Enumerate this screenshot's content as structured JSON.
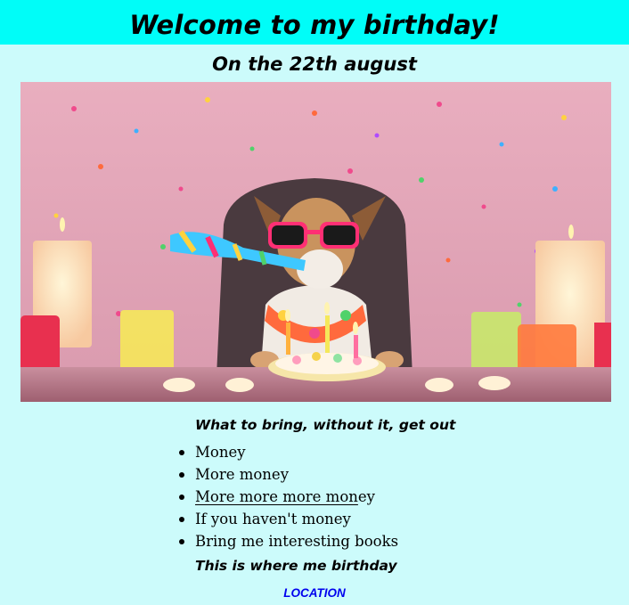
{
  "header": {
    "title": "Welcome to my birthday!",
    "subtitle": "On the 22th august"
  },
  "hero_image": {
    "icon": "party-dog-photo"
  },
  "bring": {
    "heading": "What to bring, without it, get out",
    "items": [
      "Money",
      "More money",
      "More more more money",
      "If you haven't money",
      "Bring me interesting books"
    ],
    "item3_underlined": "More more more mon",
    "item3_rest": "ey"
  },
  "where": {
    "heading": "This is where me birthday",
    "link_label": "LOCATION"
  },
  "colors": {
    "header_bg": "#00fdf8",
    "page_bg": "#ccfbfb",
    "link": "#0000ee"
  }
}
